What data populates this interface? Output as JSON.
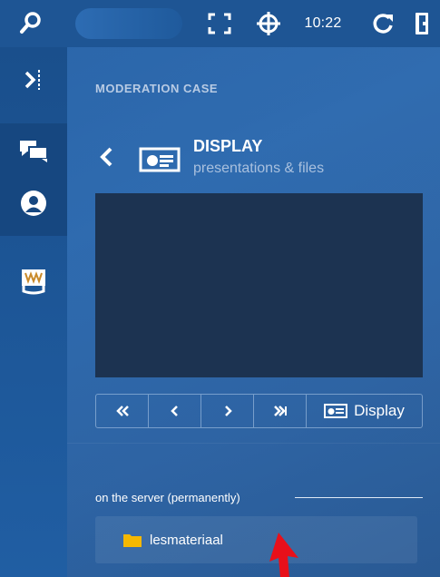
{
  "topbar": {
    "time": "10:22",
    "icons": [
      "search-icon",
      "status-dot-icon",
      "fullscreen-icon",
      "target-icon",
      "refresh-icon",
      "exit-door-icon"
    ]
  },
  "rail": {
    "icons": [
      "collapse-panel-icon",
      "chat-icon",
      "user-icon",
      "whiteboard-icon"
    ]
  },
  "panel": {
    "section_title": "MODERATION CASE",
    "display_title": "DISPLAY",
    "display_subtitle": "presentations & files",
    "controls": {
      "first": "K",
      "prev": "<",
      "next": ">",
      "last": ">I",
      "display_label": "Display"
    },
    "server_label": "on the server (permanently)",
    "folder_name": "lesmateriaal"
  },
  "colors": {
    "background": "#2a6bb3",
    "topbar": "#1e5594",
    "preview": "#1c3351",
    "folder": "#f5b800",
    "cursor": "#e8101a"
  }
}
